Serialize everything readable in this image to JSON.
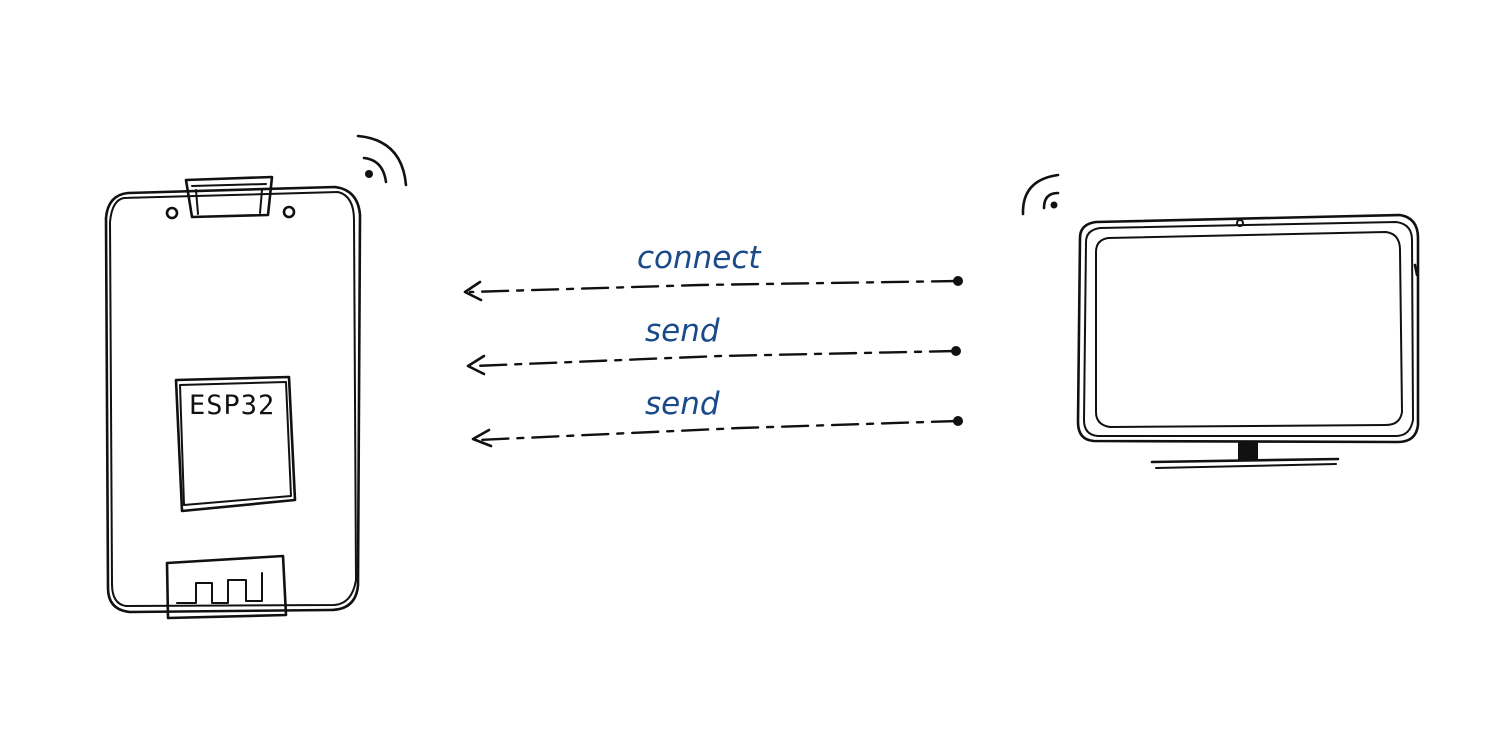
{
  "devices": {
    "board": {
      "chip_label": "ESP32"
    }
  },
  "messages": [
    {
      "label": "connect"
    },
    {
      "label": "send"
    },
    {
      "label": "send"
    }
  ],
  "colors": {
    "ink": "#111111",
    "message_text": "#1a4a8a",
    "background": "#ffffff"
  },
  "icons": {
    "board_antenna": "wifi-signal-icon",
    "monitor_antenna": "wifi-signal-icon",
    "board_pcb_antenna": "pcb-antenna-icon"
  }
}
